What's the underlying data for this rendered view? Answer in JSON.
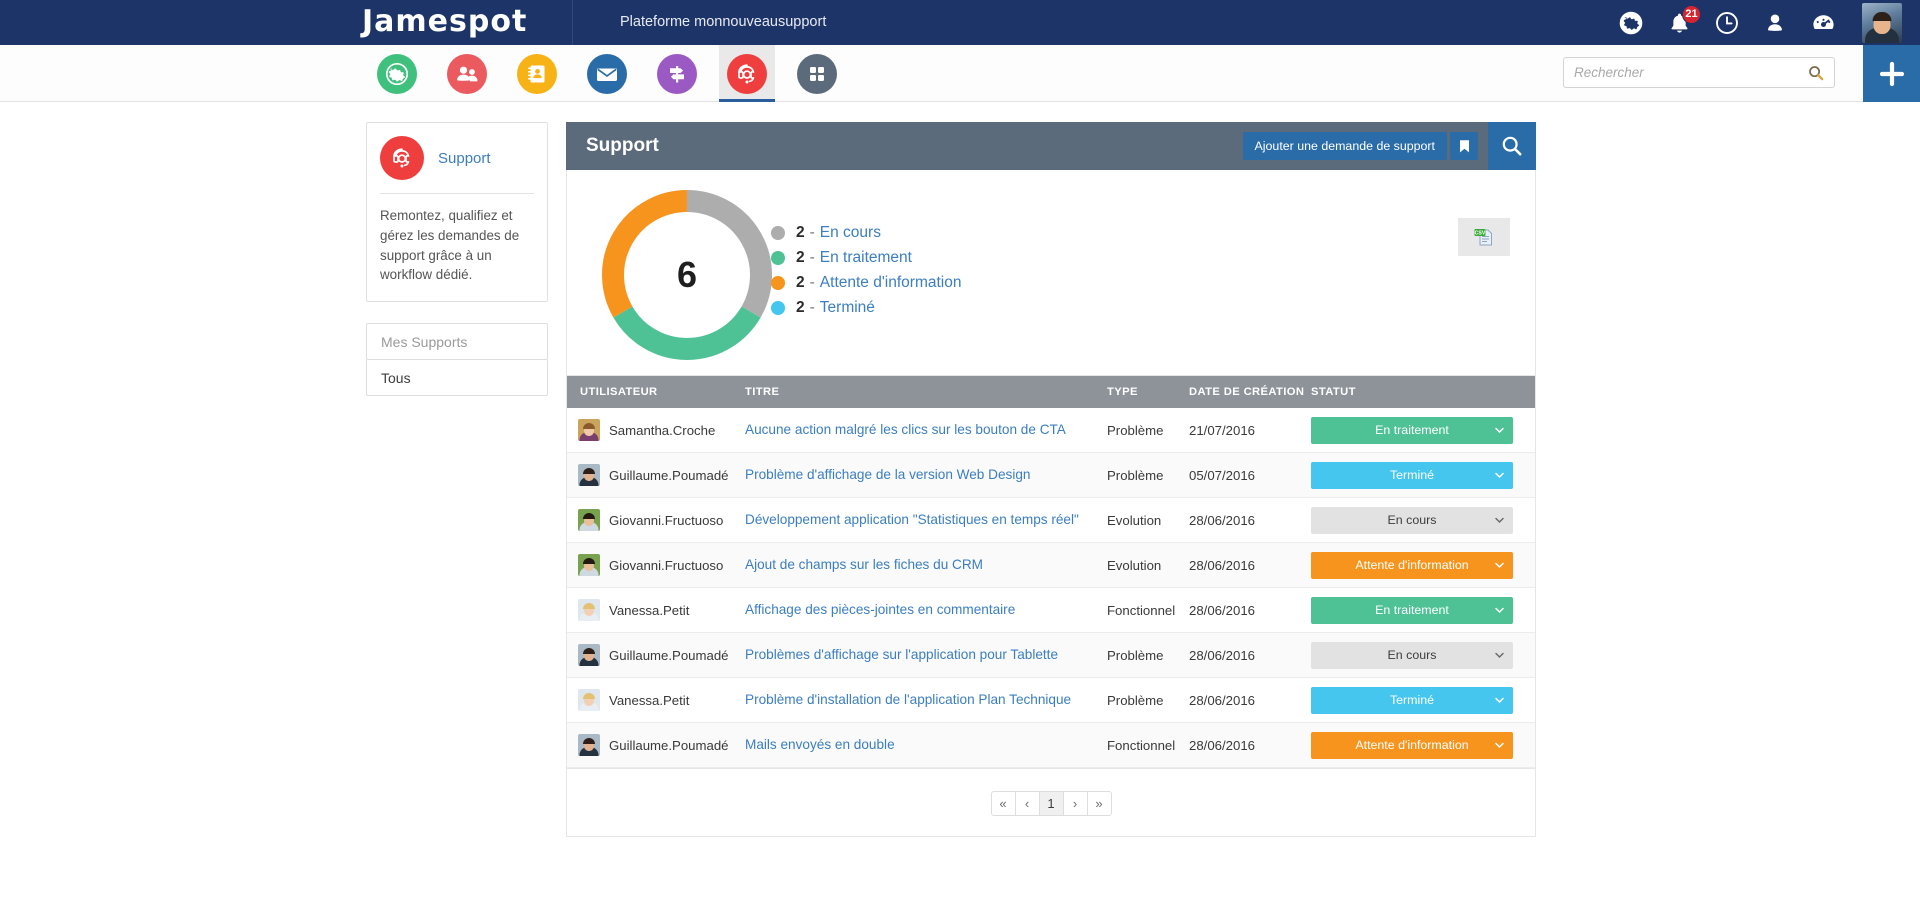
{
  "topbar": {
    "logo": "Jamespot",
    "platform_name": "Plateforme monnouveausupport",
    "icons": [
      {
        "name": "globe-icon",
        "label": "Langue"
      },
      {
        "name": "bell-icon",
        "label": "Notifications",
        "badge": "21"
      },
      {
        "name": "clock-icon",
        "label": "Historique"
      },
      {
        "name": "user-icon",
        "label": "Profil"
      },
      {
        "name": "dashboard-icon",
        "label": "Tableau de bord"
      }
    ],
    "avatar_alt": "Mon avatar"
  },
  "navbar": {
    "apps": [
      {
        "name": "globe-app",
        "label": "Accueil",
        "color": "#3fc07c",
        "active": false
      },
      {
        "name": "community-app",
        "label": "Communautés",
        "color": "#ea5a5f",
        "active": false
      },
      {
        "name": "directory-app",
        "label": "Annuaire",
        "color": "#f7b316",
        "active": false
      },
      {
        "name": "mail-app",
        "label": "Messagerie",
        "color": "#2a6ca8",
        "active": false
      },
      {
        "name": "signpost-app",
        "label": "Navigation",
        "color": "#9b59c4",
        "active": false
      },
      {
        "name": "support-app",
        "label": "Support",
        "color": "#ef3e3e",
        "active": true
      },
      {
        "name": "apps-grid",
        "label": "Applications",
        "color": "#5b6b7c",
        "active": false
      }
    ],
    "search_placeholder": "Rechercher",
    "search_value": "",
    "add_label": "+"
  },
  "sidebar": {
    "card": {
      "title": "Support",
      "icon": "headset-icon",
      "description": "Remontez, qualifiez et gérez les demandes de support grâce à un workflow dédié."
    },
    "menu": [
      {
        "label": "Mes Supports",
        "muted": true
      },
      {
        "label": "Tous",
        "muted": false
      }
    ]
  },
  "main": {
    "title": "Support",
    "add_button": "Ajouter une demande de support",
    "bookmark_icon": "bookmark-icon",
    "search_icon": "search-icon",
    "export_icon": "csv-export-icon"
  },
  "chart_data": {
    "type": "pie",
    "title": "Répartition des demandes de support par statut",
    "center_total": "6",
    "legend_position": "right",
    "categories": [
      "En cours",
      "En traitement",
      "Attente d'information",
      "Terminé"
    ],
    "values": [
      2,
      2,
      2,
      2
    ],
    "colors": [
      "#adadad",
      "#4ec295",
      "#f7941d",
      "#45c6ef"
    ],
    "rendered_segments": [
      {
        "label": "En cours",
        "color": "#adadad",
        "value": 2,
        "start_deg": 0,
        "end_deg": 120
      },
      {
        "label": "En traitement",
        "color": "#4ec295",
        "value": 2,
        "start_deg": 120,
        "end_deg": 240
      },
      {
        "label": "Attente d'information",
        "color": "#f7941d",
        "value": 2,
        "start_deg": 240,
        "end_deg": 360
      }
    ],
    "legend": [
      {
        "count": "2",
        "dash": "-",
        "label": "En cours",
        "color": "#adadad"
      },
      {
        "count": "2",
        "dash": "-",
        "label": "En traitement",
        "color": "#4ec295"
      },
      {
        "count": "2",
        "dash": "-",
        "label": "Attente d'information",
        "color": "#f7941d"
      },
      {
        "count": "2",
        "dash": "-",
        "label": "Terminé",
        "color": "#45c6ef"
      }
    ]
  },
  "table": {
    "columns": [
      "UTILISATEUR",
      "TITRE",
      "TYPE",
      "DATE DE CRÉATION",
      "STATUT"
    ],
    "rows": [
      {
        "user": "Samantha.Croche",
        "title": "Aucune action malgré les clics sur les bouton de CTA",
        "type": "Problème",
        "date": "21/07/2016",
        "status": "En traitement",
        "status_color": "#4ec295",
        "status_style": "color",
        "avatar": {
          "bg": "#caa45c",
          "skin": "#f0c9a8",
          "hair": "#8a5a2b",
          "body": "#7a3f6d"
        }
      },
      {
        "user": "Guillaume.Poumadé",
        "title": "Problème d'affichage de la version Web Design",
        "type": "Problème",
        "date": "05/07/2016",
        "status": "Terminé",
        "status_color": "#45c6ef",
        "status_style": "color",
        "avatar": {
          "bg": "#aab9c6",
          "skin": "#e2b391",
          "hair": "#2e2018",
          "body": "#26323f"
        }
      },
      {
        "user": "Giovanni.Fructuoso",
        "title": "Développement application \"Statistiques en temps réel\"",
        "type": "Evolution",
        "date": "28/06/2016",
        "status": "En cours",
        "status_color": "#e2e2e2",
        "status_style": "grey",
        "avatar": {
          "bg": "#79a24e",
          "skin": "#e9bf9c",
          "hair": "#241a12",
          "body": "#cfd9e2"
        }
      },
      {
        "user": "Giovanni.Fructuoso",
        "title": "Ajout de champs sur les fiches du CRM",
        "type": "Evolution",
        "date": "28/06/2016",
        "status": "Attente d'information",
        "status_color": "#f7941d",
        "status_style": "color",
        "avatar": {
          "bg": "#79a24e",
          "skin": "#e9bf9c",
          "hair": "#241a12",
          "body": "#cfd9e2"
        }
      },
      {
        "user": "Vanessa.Petit",
        "title": "Affichage des pièces-jointes en commentaire",
        "type": "Fonctionnel",
        "date": "28/06/2016",
        "status": "En traitement",
        "status_color": "#4ec295",
        "status_style": "color",
        "avatar": {
          "bg": "#dfe7ee",
          "skin": "#f3d0b4",
          "hair": "#e3c072",
          "body": "#e8eef3"
        }
      },
      {
        "user": "Guillaume.Poumadé",
        "title": "Problèmes d'affichage sur l'application pour Tablette",
        "type": "Problème",
        "date": "28/06/2016",
        "status": "En cours",
        "status_color": "#e2e2e2",
        "status_style": "grey",
        "avatar": {
          "bg": "#aab9c6",
          "skin": "#e2b391",
          "hair": "#2e2018",
          "body": "#26323f"
        }
      },
      {
        "user": "Vanessa.Petit",
        "title": "Problème d'installation de l'application Plan Technique",
        "type": "Problème",
        "date": "28/06/2016",
        "status": "Terminé",
        "status_color": "#45c6ef",
        "status_style": "color",
        "avatar": {
          "bg": "#dfe7ee",
          "skin": "#f3d0b4",
          "hair": "#e3c072",
          "body": "#e8eef3"
        }
      },
      {
        "user": "Guillaume.Poumadé",
        "title": "Mails envoyés en double",
        "type": "Fonctionnel",
        "date": "28/06/2016",
        "status": "Attente d'information",
        "status_color": "#f7941d",
        "status_style": "color",
        "avatar": {
          "bg": "#aab9c6",
          "skin": "#e2b391",
          "hair": "#2e2018",
          "body": "#26323f"
        }
      }
    ]
  },
  "pagination": {
    "buttons": [
      "«",
      "‹",
      "1",
      "›",
      "»"
    ],
    "active_index": 2
  }
}
